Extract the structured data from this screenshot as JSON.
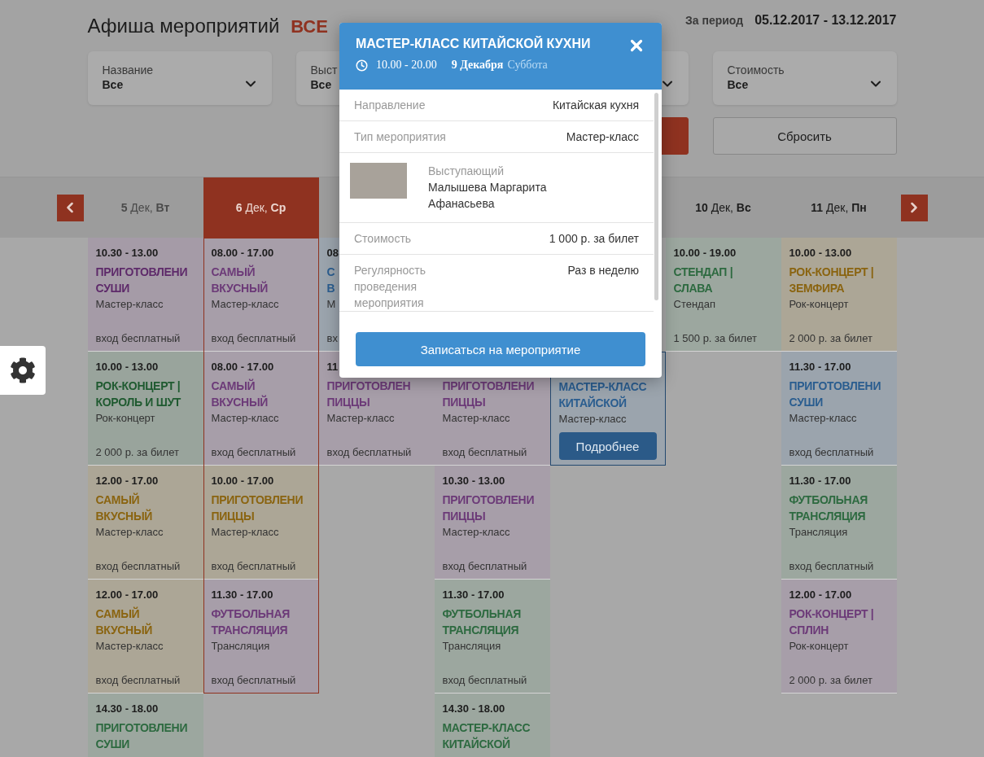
{
  "page": {
    "title": "Афиша мероприятий",
    "scope": "ВСЕ",
    "period_label": "За период",
    "period": "05.12.2017 - 13.12.2017"
  },
  "filters": [
    {
      "kind": "dropdown",
      "label": "Название",
      "value": "Все"
    },
    {
      "kind": "dropdown",
      "label": "Выст",
      "value": "Все"
    },
    {
      "kind": "covered"
    },
    {
      "kind": "dropdown",
      "label": "Стоимость",
      "value": "Все"
    }
  ],
  "actions": [
    {
      "kind": "apply"
    },
    {
      "kind": "reset",
      "label": "Сбросить"
    }
  ],
  "days": [
    {
      "label": "**5** Дек, **Вт**",
      "past": true,
      "selected": false,
      "cards": [
        {
          "kind": "event",
          "color": "#5e2a6a",
          "time": "10.30 - 13.00",
          "title": "ПРИГОТОВЛЕНИ СУШИ",
          "type": "Мастер-класс",
          "price": "вход бесплатный"
        },
        {
          "kind": "event",
          "color": "#1f5a30",
          "time": "10.00 - 13.00",
          "title": "РОК-КОНЦЕРТ | КОРОЛЬ И ШУТ",
          "type": "Рок-концерт",
          "price": "2 000 р. за билет"
        },
        {
          "kind": "event",
          "color": "#8a6410",
          "time": "12.00 - 17.00",
          "title": "САМЫЙ ВКУСНЫЙ",
          "type": "Мастер-класс",
          "price": "вход бесплатный"
        },
        {
          "kind": "event",
          "color": "#8a6410",
          "time": "12.00 - 17.00",
          "title": "САМЫЙ ВКУСНЫЙ",
          "type": "Мастер-класс",
          "price": "вход бесплатный"
        },
        {
          "kind": "event",
          "color": "#2d6a40",
          "time": "14.30 - 18.00",
          "title": "ПРИГОТОВЛЕНИ СУШИ"
        }
      ]
    },
    {
      "label": "**6** Дек, **Ср**",
      "past": false,
      "selected": true,
      "cards": [
        {
          "kind": "event",
          "color": "#6c3a78",
          "time": "08.00 - 17.00",
          "title": "САМЫЙ ВКУСНЫЙ",
          "type": "Мастер-класс",
          "price": "вход бесплатный"
        },
        {
          "kind": "event",
          "color": "#6c3a78",
          "time": "08.00 - 17.00",
          "title": "САМЫЙ ВКУСНЫЙ",
          "type": "Мастер-класс",
          "price": "вход бесплатный"
        },
        {
          "kind": "event",
          "color": "#8a6410",
          "time": "10.00 - 17.00",
          "title": "ПРИГОТОВЛЕНИ ПИЦЦЫ",
          "type": "Мастер-класс",
          "price": "вход бесплатный"
        },
        {
          "kind": "event",
          "color": "#6c3a78",
          "time": "11.30 - 17.00",
          "title": "ФУТБОЛЬНАЯ ТРАНСЛЯЦИЯ",
          "type": "Трансляция",
          "price": "вход бесплатный"
        }
      ]
    },
    {
      "cards": [
        {
          "kind": "clipped",
          "color": "#2a5d8f",
          "time": "08",
          "title": "С В",
          "type": "М",
          "price": "вх"
        },
        {
          "kind": "event",
          "color": "#6c3a78",
          "time": "11",
          "title": "ПРИГОТОВЛЕН ПИЦЦЫ",
          "type": "Мастер-класс",
          "price": "вход бесплатный"
        }
      ]
    },
    {
      "cards": [
        {
          "kind": "covered"
        },
        {
          "kind": "event",
          "color": "#6c3a78",
          "title": "ПРИГОТОВЛЕНИ ПИЦЦЫ",
          "type": "Мастер-класс",
          "price": "вход бесплатный"
        },
        {
          "kind": "event",
          "color": "#6c3a78",
          "time": "10.30 - 13.00",
          "title": "ПРИГОТОВЛЕНИ ПИЦЦЫ",
          "type": "Мастер-класс",
          "price": "вход бесплатный"
        },
        {
          "kind": "event",
          "color": "#2d6a40",
          "time": "11.30 - 17.00",
          "title": "ФУТБОЛЬНАЯ ТРАНСЛЯЦИЯ",
          "type": "Трансляция",
          "price": "вход бесплатный"
        },
        {
          "kind": "event",
          "color": "#2d6a40",
          "time": "14.30 - 18.00",
          "title": "МАСТЕР-КЛАСС КИТАЙСКОЙ"
        }
      ]
    },
    {
      "cards": [
        {
          "kind": "covered"
        },
        {
          "kind": "preview",
          "color": "#2a5d8f",
          "title": "МАСТЕР-КЛАСС КИТАЙСКОЙ",
          "type": "Мастер-класс",
          "button": "Подробнее"
        }
      ]
    },
    {
      "label": "**10** Дек, **Вс**",
      "past": false,
      "selected": false,
      "cards": [
        {
          "kind": "event",
          "color": "#2d6a40",
          "time": "10.00 - 19.00",
          "title": "СТЕНДАП | СЛАВА",
          "type": "Стендап",
          "price": "1 500 р. за билет"
        }
      ]
    },
    {
      "label": "**11** Дек, **Пн**",
      "past": false,
      "selected": false,
      "cards": [
        {
          "kind": "event",
          "color": "#8a6410",
          "time": "10.00 - 13.00",
          "title": "РОК-КОНЦЕРТ | ЗЕМФИРА",
          "type": "Рок-концерт",
          "price": "2 000 р. за билет"
        },
        {
          "kind": "event",
          "color": "#2a5d8f",
          "time": "11.30 - 17.00",
          "title": "ПРИГОТОВЛЕНИ СУШИ",
          "type": "Мастер-класс",
          "price": "вход бесплатный"
        },
        {
          "kind": "event",
          "color": "#2d6a40",
          "time": "11.30 - 17.00",
          "title": "ФУТБОЛЬНАЯ ТРАНСЛЯЦИЯ",
          "type": "Трансляция",
          "price": "вход бесплатный"
        },
        {
          "kind": "event",
          "color": "#6c3a78",
          "time": "12.00 - 17.00",
          "title": "РОК-КОНЦЕРТ | СПЛИН",
          "type": "Рок-концерт",
          "price": "2 000 р. за билет"
        }
      ]
    }
  ],
  "modal": {
    "title": "МАСТЕР-КЛАСС КИТАЙСКОЙ КУХНИ",
    "time": "10.00 - 20.00",
    "date": "9 Декабря",
    "weekday": "Суббота",
    "rows": [
      {
        "kind": "field",
        "label": "Направление",
        "value": "Китайская кухня"
      },
      {
        "kind": "field",
        "label": "Тип мероприятия",
        "value": "Мастер-класс"
      },
      {
        "kind": "speaker",
        "label": "Выступающий",
        "value": "Малышева Маргарита Афанасьева"
      },
      {
        "kind": "field",
        "label": "Стоимость",
        "value": "1 000 р. за билет"
      },
      {
        "kind": "field",
        "label": "Регулярность проведения мероприятия",
        "value": "Раз в неделю"
      }
    ],
    "button": "Записаться на мероприятие"
  }
}
